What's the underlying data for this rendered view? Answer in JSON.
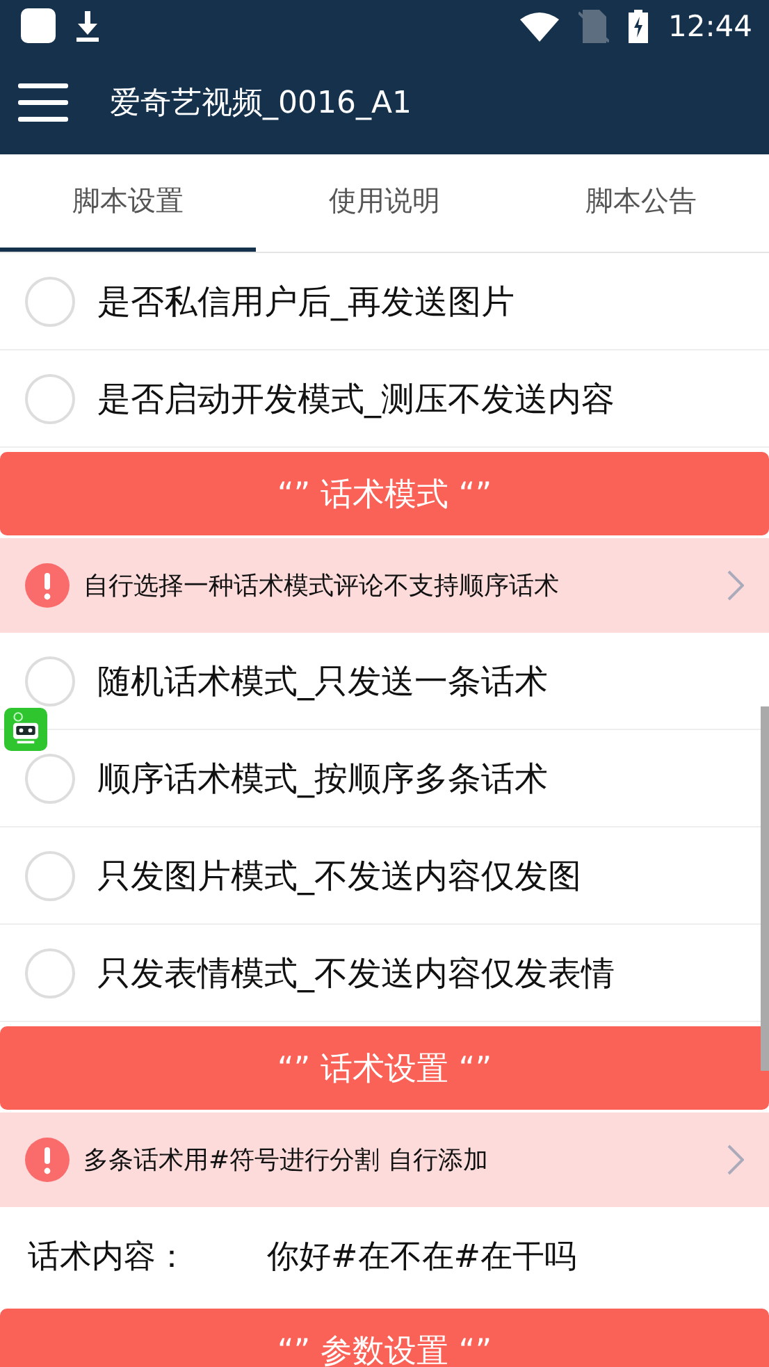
{
  "status_bar": {
    "time": "12:44"
  },
  "app_bar": {
    "title": "爱奇艺视频_0016_A1"
  },
  "tabs": [
    {
      "label": "脚本设置",
      "selected": true
    },
    {
      "label": "使用说明",
      "selected": false
    },
    {
      "label": "脚本公告",
      "selected": false
    }
  ],
  "content": [
    {
      "kind": "option",
      "label": "是否私信用户后_再发送图片",
      "selected": false
    },
    {
      "kind": "option",
      "label": "是否启动开发模式_测压不发送内容",
      "selected": false
    },
    {
      "kind": "header",
      "label": "“” 话术模式 “”"
    },
    {
      "kind": "notice",
      "label": "自行选择一种话术模式评论不支持顺序话术"
    },
    {
      "kind": "option",
      "label": "随机话术模式_只发送一条话术",
      "selected": false
    },
    {
      "kind": "option",
      "label": "顺序话术模式_按顺序多条话术",
      "selected": false
    },
    {
      "kind": "option",
      "label": "只发图片模式_不发送内容仅发图",
      "selected": false
    },
    {
      "kind": "option",
      "label": "只发表情模式_不发送内容仅发表情",
      "selected": false
    },
    {
      "kind": "header",
      "label": "“” 话术设置 “”"
    },
    {
      "kind": "notice",
      "label": "多条话术用#符号进行分割 自行添加"
    },
    {
      "kind": "field",
      "label": "话术内容：",
      "value": "你好#在不在#在干吗"
    },
    {
      "kind": "header",
      "label": "“” 参数设置 “”"
    }
  ]
}
